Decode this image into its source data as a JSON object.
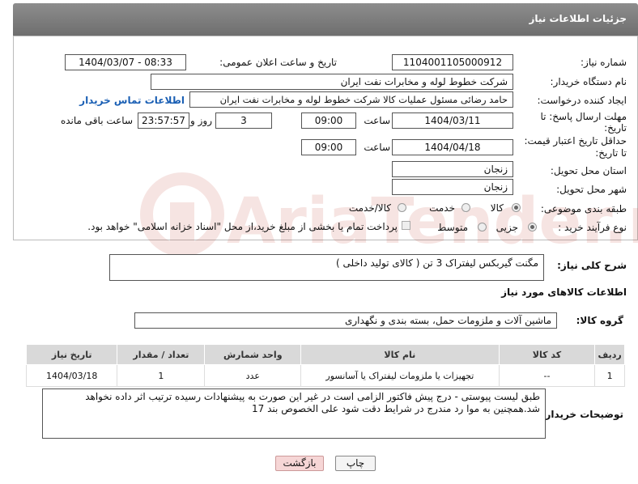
{
  "header": {
    "title": "جزئیات اطلاعات نیاز"
  },
  "fields": {
    "need_number_label": "شماره نیاز:",
    "need_number": "1104001105000912",
    "announce_label": "تاریخ و ساعت اعلان عمومی:",
    "announce_value": "1404/03/07 - 08:33",
    "buyer_org_label": "نام دستگاه خریدار:",
    "buyer_org": "شرکت خطوط لوله و مخابرات نفت ایران",
    "requester_label": "ایجاد کننده درخواست:",
    "requester": "حامد  رضائی  مسئول عملیات کالا  شرکت خطوط لوله و مخابرات نفت ایران",
    "contact_link": "اطلاعات تماس خریدار",
    "deadline_label_1": "مهلت ارسال پاسخ: تا",
    "deadline_label_2": "تاریخ:",
    "deadline_date": "1404/03/11",
    "time_label": "ساعت",
    "deadline_time": "09:00",
    "days_value": "3",
    "days_label": "روز و",
    "remaining_time": "23:57:57",
    "remaining_label": "ساعت باقی مانده",
    "validity_label_1": "حداقل تاریخ اعتبار قیمت:",
    "validity_label_2": "تا تاریخ:",
    "validity_date": "1404/04/18",
    "validity_time": "09:00",
    "province_label": "استان محل تحویل:",
    "province": "زنجان",
    "city_label": "شهر محل تحویل:",
    "city": "زنجان",
    "category_label": "طبقه بندی موضوعی:",
    "category_options": [
      "کالا",
      "خدمت",
      "کالا/خدمت"
    ],
    "category_selected": "کالا",
    "process_label": "نوع فرآیند خرید :",
    "process_options": [
      "جزیی",
      "متوسط"
    ],
    "process_selected": "جزیی",
    "payment_note": "پرداخت تمام یا بخشی از مبلغ خرید،از محل \"اسناد خزانه اسلامی\" خواهد بود."
  },
  "description": {
    "label": "شرح کلی نیاز:",
    "value": "مگنت گیربکس لیفتراک 3 تن ( کالای تولید داخلی )"
  },
  "goods_info": {
    "title": "اطلاعات کالاهای مورد نیاز",
    "group_label": "گروه کالا:",
    "group_value": "ماشین آلات و ملزومات حمل، بسته بندی و نگهداری"
  },
  "table": {
    "headers": [
      "ردیف",
      "کد کالا",
      "نام کالا",
      "واحد شمارش",
      "تعداد / مقدار",
      "تاریخ نیاز"
    ],
    "rows": [
      [
        "1",
        "--",
        "تجهیزات یا ملزومات لیفتراک یا آسانسور",
        "عدد",
        "1",
        "1404/03/18"
      ]
    ]
  },
  "buyer_notes": {
    "label": "توضیحات خریدار:",
    "value": "طبق لیست پیوستی - درج پیش فاکتور الزامی است در غیر این صورت به پیشنهادات رسیده ترتیب اثر داده نخواهد شد.همچنین به موا رد مندرج در شرایط دقت شود علی الخصوص بند 17"
  },
  "buttons": {
    "print": "چاپ",
    "back": "بازگشت"
  },
  "watermark": {
    "text": "AriaTender.net"
  },
  "colors": {
    "header": "#7a7a7a",
    "link": "#1a5fb4",
    "watermark": "#c0392b",
    "back_button": "#f6d6d6"
  }
}
